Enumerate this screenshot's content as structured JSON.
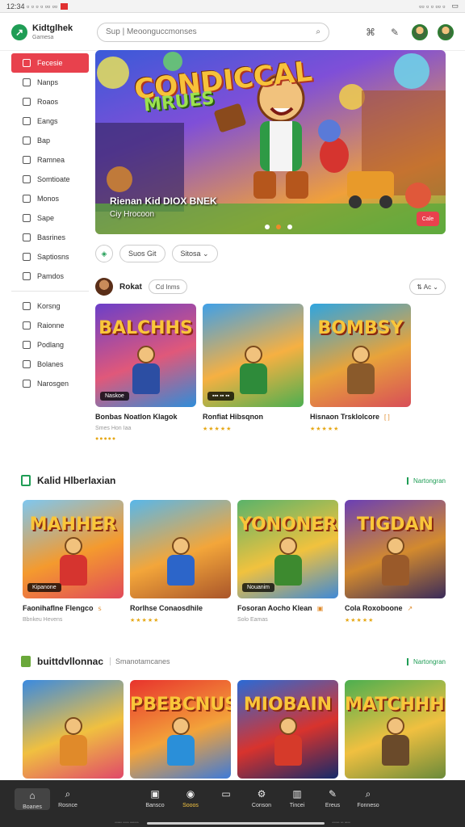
{
  "status_bar": {
    "left": "12:34 ▫ ▫ ▫ ▫ ▫▫ ▫▫",
    "right": "▫▫ ▫ ▫ ▫▫ ▫"
  },
  "header": {
    "logo_name": "Kidtglhek",
    "logo_sub": "Gamesa",
    "search_placeholder": "Sup | Meoonguccmonses"
  },
  "sidebar": {
    "items": [
      {
        "label": "Fecesie",
        "active": true
      },
      {
        "label": "Nanps"
      },
      {
        "label": "Roaos"
      },
      {
        "label": "Eangs"
      },
      {
        "label": "Bap"
      },
      {
        "label": "Ramnea"
      },
      {
        "label": "Somtioate"
      },
      {
        "label": "Monos"
      },
      {
        "label": "Sape"
      },
      {
        "label": "Basrines"
      },
      {
        "label": "Saptiosns"
      },
      {
        "label": "Pamdos"
      }
    ],
    "items2": [
      {
        "label": "Korsng"
      },
      {
        "label": "Raionne"
      },
      {
        "label": "Podlang"
      },
      {
        "label": "Bolanes"
      },
      {
        "label": "Narosgen"
      }
    ]
  },
  "hero": {
    "title_line1": "CONDICCAL",
    "title_line2": "MRUES",
    "subtitle": "Rienan Kid DIOX BNEK",
    "caption": "Ciy Hrocoon",
    "cta_label": "Cale",
    "slide_count": 3,
    "active_slide": 2
  },
  "filters": {
    "chips": [
      {
        "label": "Suos  Git"
      },
      {
        "label": "Sitosa ⌄"
      }
    ]
  },
  "featured_row": {
    "title": "Rokat",
    "chip": "Cd Inms",
    "sort_label": "⇅  Ac  ⌄",
    "cards": [
      {
        "thumb_text": "BALCHHS",
        "badge": "Naskoe",
        "title": "Bonbas Noatlon Klagok",
        "trail": "",
        "meta": "Smes Hon Iaa",
        "stars": "●●●●●",
        "colors": [
          "#6b3fc9",
          "#e0587a",
          "#2f8dd9"
        ],
        "body": "#2c4ea3"
      },
      {
        "thumb_text": "",
        "badge": "▪▪▪ ▪▪ ▪▪",
        "title": "Ronfiat  Hibsqnon",
        "trail": "",
        "meta": "",
        "stars": "★★★★★",
        "colors": [
          "#3fa0e8",
          "#f6b042",
          "#4caf50"
        ],
        "body": "#2e8b3a"
      },
      {
        "thumb_text": "BOMBSY",
        "badge": "",
        "title": "Hisnaon  Trsklolcore",
        "trail": "[ ]",
        "meta": "",
        "stars": "★★★★★",
        "colors": [
          "#2fa5e0",
          "#e8a33a",
          "#d84e58"
        ],
        "body": "#8a5a2b"
      }
    ]
  },
  "section2": {
    "title": "Kalid Hlberlaxian",
    "subtitle": "",
    "link": "Nartongran",
    "cards": [
      {
        "thumb_text": "MAHHER",
        "badge": "Kipanone",
        "title": "Faonihaflne  Flengco",
        "trail": "ꜱ",
        "meta": "Bbnkeu Hevens",
        "stars": "",
        "colors": [
          "#7ec7f0",
          "#f49a2e",
          "#e14a5a"
        ],
        "body": "#d6342f"
      },
      {
        "thumb_text": "",
        "badge": "",
        "title": "Rorlhse Conaosdhile",
        "trail": "",
        "meta": "",
        "stars": "★★★★★",
        "colors": [
          "#58b7ea",
          "#f3a63a",
          "#a9552a"
        ],
        "body": "#2c65c9"
      },
      {
        "thumb_text": "YONONER",
        "badge": "Nouanim",
        "title": "Fosoran Aocho Klean",
        "trail": "▣",
        "meta": "Solo Eamas",
        "stars": "",
        "colors": [
          "#5ab36a",
          "#f1c23e",
          "#3f89d6"
        ],
        "body": "#3d8a2f"
      },
      {
        "thumb_text": "TIGDAN",
        "badge": "",
        "title": "Cola Roxoboone",
        "trail": "↗",
        "meta": "",
        "stars": "★★★★★",
        "colors": [
          "#6a3fb5",
          "#d38a2e",
          "#3a2b5a"
        ],
        "body": "#9a5a2a"
      }
    ]
  },
  "section3": {
    "title": "buittdvllonnac",
    "subtitle": "Smanotamcanes",
    "link": "Nartongran",
    "cards": [
      {
        "thumb_text": "",
        "colors": [
          "#3a8ae0",
          "#f0c040",
          "#e0486a"
        ],
        "body": "#e08a2a"
      },
      {
        "thumb_text": "PBEBCNUS",
        "colors": [
          "#e8332d",
          "#f3a33a",
          "#3e7ad8"
        ],
        "body": "#2a8fd9"
      },
      {
        "thumb_text": "MIOBAIN",
        "colors": [
          "#2a6ad6",
          "#d8332d",
          "#142a6a"
        ],
        "body": "#d63a2a"
      },
      {
        "thumb_text": "MATCHHHIS",
        "colors": [
          "#4caf50",
          "#f0c040",
          "#6a8a3a"
        ],
        "body": "#6a4a2a"
      }
    ]
  },
  "navbar": {
    "items": [
      {
        "label": "Boanes",
        "icon": "⌂",
        "name": "home"
      },
      {
        "label": "Rosnce",
        "icon": "⌕",
        "name": "search"
      },
      {
        "label": "Bansco",
        "icon": "▣",
        "name": "play"
      },
      {
        "label": "Sooos",
        "icon": "◉",
        "name": "coins"
      },
      {
        "label": "",
        "icon": "▭",
        "name": "card"
      },
      {
        "label": "Conson",
        "icon": "⚙",
        "name": "settings"
      },
      {
        "label": "Tincei",
        "icon": "▥",
        "name": "library"
      },
      {
        "label": "Ereus",
        "icon": "✎",
        "name": "edit"
      },
      {
        "label": "Fonneso",
        "icon": "⌕",
        "name": "find"
      }
    ]
  },
  "home_bar": {
    "left": "▫▫▫▫▫ ▫▫▫▫ ▫▫▫▫▫▫",
    "right": "▫▫▫▫▫ ▫▫ ▫▫▫▫"
  },
  "colors": {
    "accent": "#e8414d",
    "brand_green": "#1f9d55",
    "nav_bg": "#2a2a2a"
  }
}
